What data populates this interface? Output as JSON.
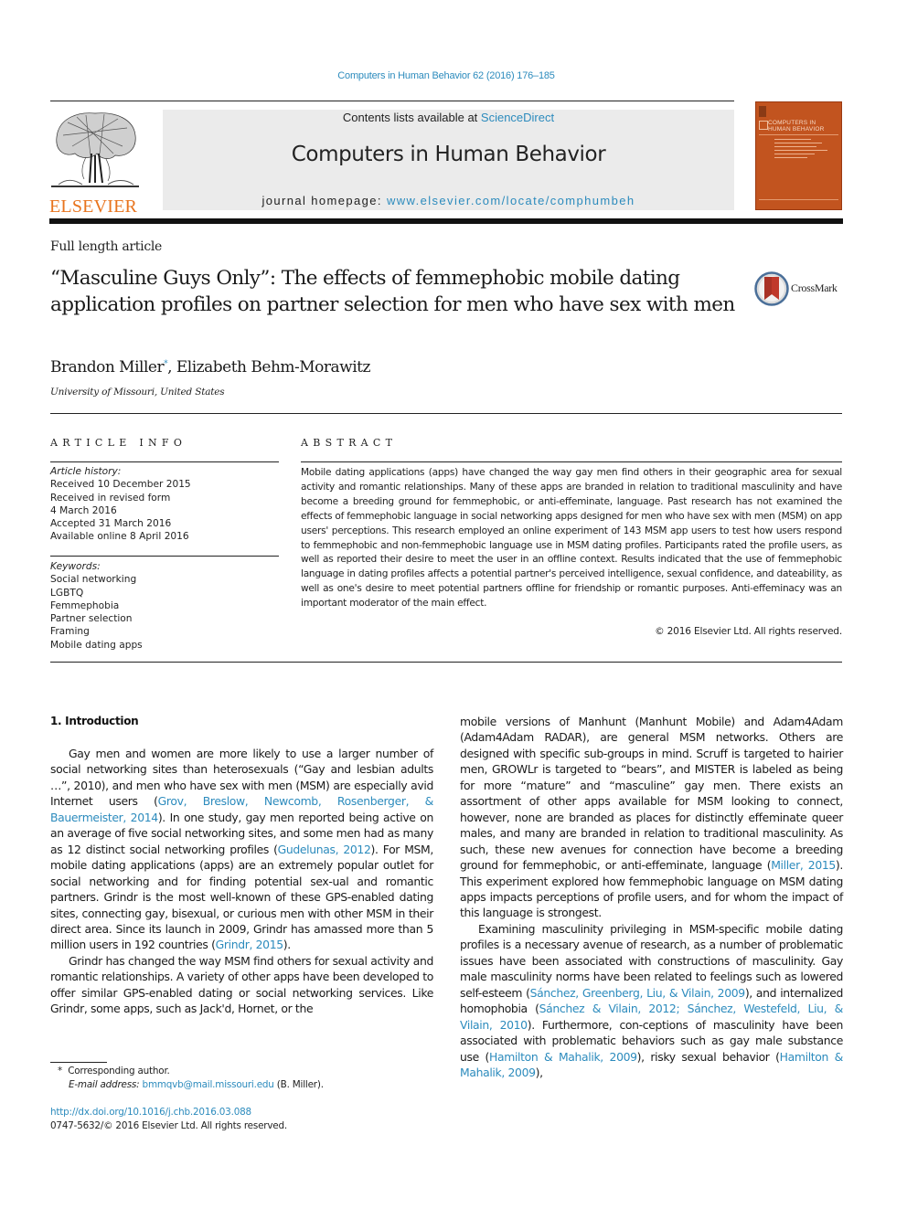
{
  "header": {
    "citation": "Computers in Human Behavior 62 (2016) 176–185",
    "contents_prefix": "Contents lists available at ",
    "contents_link": "ScienceDirect",
    "journal_title": "Computers in Human Behavior",
    "homepage_prefix": "journal homepage: ",
    "homepage_link": "www.elsevier.com/locate/comphumbeh",
    "publisher_logo_text": "ELSEVIER",
    "cover_title_line1": "COMPUTERS IN",
    "cover_title_line2": "HUMAN BEHAVIOR"
  },
  "article": {
    "type": "Full length article",
    "title": "“Masculine Guys Only”: The effects of femmephobic mobile dating application profiles on partner selection for men who have sex with men",
    "crossmark_label": "CrossMark",
    "authors": [
      {
        "name": "Brandon Miller",
        "mark": "*"
      },
      {
        "name": "Elizabeth Behm-Morawitz",
        "mark": ""
      }
    ],
    "author_separator": ", ",
    "affiliation": "University of Missouri, United States"
  },
  "article_info": {
    "heading": "ARTICLE INFO",
    "history_label": "Article history:",
    "history": [
      "Received 10 December 2015",
      "Received in revised form",
      "4 March 2016",
      "Accepted 31 March 2016",
      "Available online 8 April 2016"
    ],
    "keywords_label": "Keywords:",
    "keywords": [
      "Social networking",
      "LGBTQ",
      "Femmephobia",
      "Partner selection",
      "Framing",
      "Mobile dating apps"
    ]
  },
  "abstract": {
    "heading": "ABSTRACT",
    "body": "Mobile dating applications (apps) have changed the way gay men find others in their geographic area for sexual activity and romantic relationships. Many of these apps are branded in relation to traditional masculinity and have become a breeding ground for femmephobic, or anti-effeminate, language. Past research has not examined the effects of femmephobic language in social networking apps designed for men who have sex with men (MSM) on app users' perceptions. This research employed an online experiment of 143 MSM app users to test how users respond to femmephobic and non-femmephobic language use in MSM dating profiles. Participants rated the profile users, as well as reported their desire to meet the user in an offline context. Results indicated that the use of femmephobic language in dating profiles affects a potential partner's perceived intelligence, sexual confidence, and dateability, as well as one's desire to meet potential partners offline for friendship or romantic purposes. Anti-effeminacy was an important moderator of the main effect.",
    "copyright": "© 2016 Elsevier Ltd. All rights reserved."
  },
  "intro": {
    "heading": "1.  Introduction",
    "p1": {
      "t1": "Gay men and women are more likely to use a larger number of social networking sites than heterosexuals (“Gay and lesbian adults …”, 2010), and men who have sex with men (MSM) are especially avid Internet users (",
      "l1": "Grov, Breslow, Newcomb, Rosenberger, & Bauermeister, 2014",
      "t2": "). In one study, gay men reported being active on an average of five social networking sites, and some men had as many as 12 distinct social networking profiles (",
      "l2": "Gudelunas, 2012",
      "t3": "). For MSM, mobile dating applications (apps) are an extremely popular outlet for social networking and for finding potential sex-ual and romantic partners. Grindr is the most well-known of these GPS-enabled dating sites, connecting gay, bisexual, or curious men with other MSM in their direct area. Since its launch in 2009, Grindr has amassed more than 5 million users in 192 countries (",
      "l3": "Grindr, 2015",
      "t4": ")."
    },
    "p2": "Grindr has changed the way MSM find others for sexual activity and romantic relationships. A variety of other apps have been developed to offer similar GPS-enabled dating or social networking services. Like Grindr, some apps, such as Jack'd, Hornet, or the",
    "p3": {
      "t1": "mobile versions of Manhunt (Manhunt Mobile) and Adam4Adam (Adam4Adam RADAR), are general MSM networks. Others are designed with specific sub-groups in mind. Scruff is targeted to hairier men, GROWLr is targeted to “bears”, and MISTER is labeled as being for more “mature” and “masculine” gay men. There exists an assortment of other apps available for MSM looking to connect, however, none are branded as places for distinctly effeminate queer males, and many are branded in relation to traditional masculinity. As such, these new avenues for connection have become a breeding ground for femmephobic, or anti-effeminate, language (",
      "l1": "Miller, 2015",
      "t2": "). This experiment explored how femmephobic language on MSM dating apps impacts perceptions of profile users, and for whom the impact of this language is strongest."
    },
    "p4": {
      "t1": "Examining masculinity privileging in MSM-specific mobile dating profiles is a necessary avenue of research, as a number of problematic issues have been associated with constructions of masculinity. Gay male masculinity norms have been related to feelings such as lowered self-esteem (",
      "l1": "Sánchez, Greenberg, Liu, & Vilain, 2009",
      "t2": "), and internalized homophobia (",
      "l2": "Sánchez & Vilain, 2012; Sánchez, Westefeld, Liu, & Vilain, 2010",
      "t3": "). Furthermore, con-ceptions of masculinity have been associated with problematic behaviors such as gay male substance use (",
      "l3": "Hamilton & Mahalik, 2009",
      "t4": "), risky sexual behavior (",
      "l4": "Hamilton & Mahalik, 2009",
      "t5": "),"
    }
  },
  "footnotes": {
    "mark": "*",
    "corresponding": "Corresponding author.",
    "email_label": "E-mail address:",
    "email": "bmmqvb@mail.missouri.edu",
    "email_suffix": " (B. Miller).",
    "doi": "http://dx.doi.org/10.1016/j.chb.2016.03.088",
    "issn_copyright": "0747-5632/© 2016 Elsevier Ltd. All rights reserved."
  },
  "colors": {
    "link": "#2c8bbd",
    "elsevier_orange": "#e8741e",
    "cover_orange": "#c2541f",
    "banner_gray": "#ebebeb"
  }
}
